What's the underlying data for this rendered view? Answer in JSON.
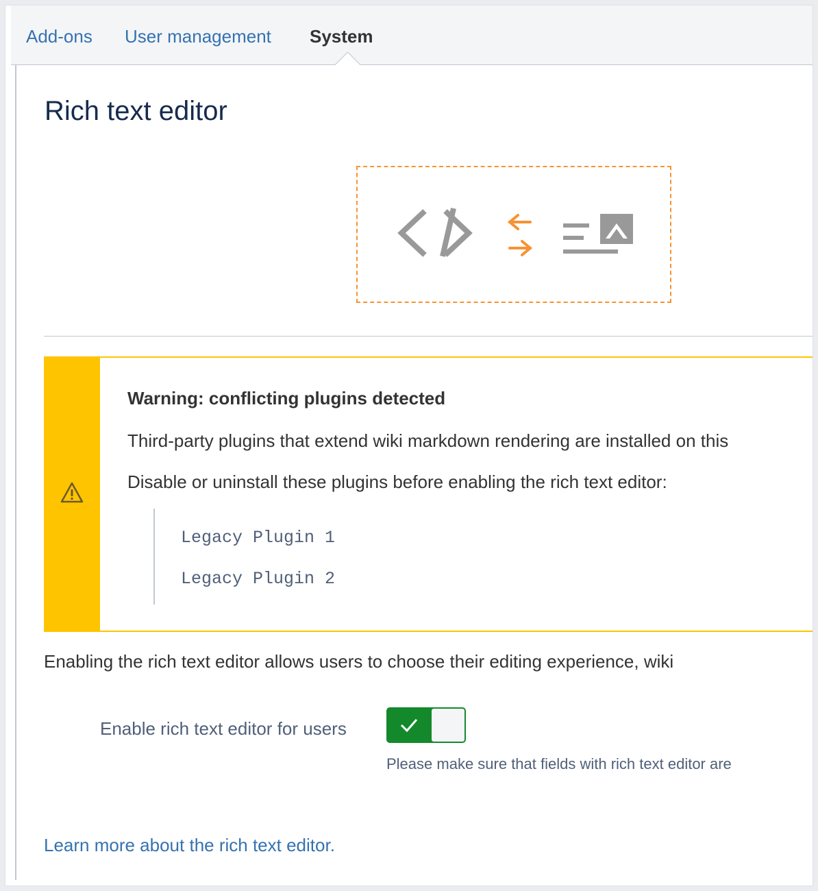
{
  "tabs": [
    {
      "label": "Add-ons",
      "active": false
    },
    {
      "label": "User management",
      "active": false
    },
    {
      "label": "System",
      "active": true
    }
  ],
  "page": {
    "title": "Rich text editor"
  },
  "illustration": {
    "icons": [
      "code-icon",
      "swap-arrows-icon",
      "rich-text-icon"
    ],
    "accent_color": "#f79232",
    "icon_color": "#999999"
  },
  "warning": {
    "icon": "warning-triangle-icon",
    "title": "Warning: conflicting plugins detected",
    "line1": "Third-party plugins that extend wiki markdown rendering are installed on this",
    "line2": "Disable or uninstall these plugins before enabling the rich text editor:",
    "plugins": [
      "Legacy Plugin 1",
      "Legacy Plugin 2"
    ],
    "color": "#ffc400"
  },
  "description": "Enabling the rich text editor allows users to choose their editing experience, wiki",
  "setting": {
    "label": "Enable rich text editor for users",
    "enabled": true,
    "toggle_color": "#14892c",
    "help": "Please make sure that fields with rich text editor are"
  },
  "learn_more": "Learn more about the rich text editor."
}
